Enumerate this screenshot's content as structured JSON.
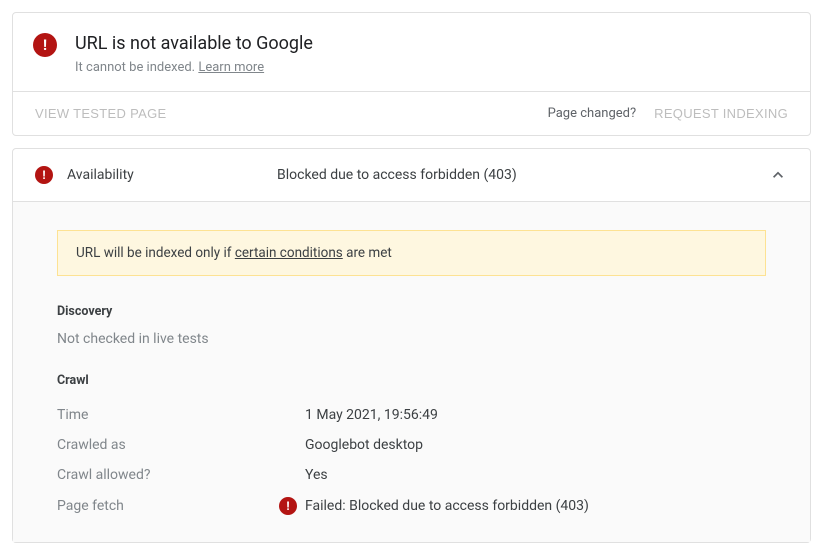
{
  "header": {
    "title": "URL is not available to Google",
    "subtitle_prefix": "It cannot be indexed. ",
    "learn_more": "Learn more"
  },
  "actions": {
    "view_tested": "VIEW TESTED PAGE",
    "page_changed": "Page changed?",
    "request_indexing": "REQUEST INDEXING"
  },
  "availability": {
    "label": "Availability",
    "value": "Blocked due to access forbidden (403)"
  },
  "banner": {
    "prefix": "URL will be indexed only if ",
    "link": "certain conditions",
    "suffix": " are met"
  },
  "discovery": {
    "heading": "Discovery",
    "text": "Not checked in live tests"
  },
  "crawl": {
    "heading": "Crawl",
    "rows": [
      {
        "key": "Time",
        "value": "1 May 2021, 19:56:49",
        "error": false
      },
      {
        "key": "Crawled as",
        "value": "Googlebot desktop",
        "error": false
      },
      {
        "key": "Crawl allowed?",
        "value": "Yes",
        "error": false
      },
      {
        "key": "Page fetch",
        "value": "Failed: Blocked due to access forbidden (403)",
        "error": true
      }
    ]
  }
}
